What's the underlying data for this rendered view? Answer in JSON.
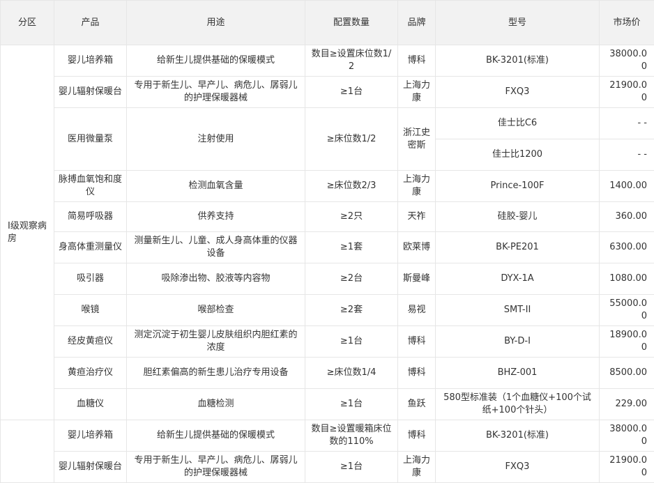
{
  "headers": [
    "分区",
    "产品",
    "用途",
    "配置数量",
    "品牌",
    "型号",
    "市场价"
  ],
  "section1": {
    "zone": "I级观察病房",
    "rows": [
      {
        "product": "婴儿培养箱",
        "usage": "给新生儿提供基础的保暖模式",
        "qty": "数目≥设置床位数1/2",
        "brand": "博科",
        "model": "BK-3201(标准)",
        "price": "38000.00"
      },
      {
        "product": "婴儿辐射保暖台",
        "usage": "专用于新生儿、早产儿、病危儿、孱弱儿的护理保暖器械",
        "qty": "≥1台",
        "brand": "上海力康",
        "model": "FXQ3",
        "price": "21900.00"
      },
      {
        "product": "医用微量泵",
        "usage": "注射使用",
        "qty": "≥床位数1/2",
        "brand": "浙江史密斯",
        "model": "佳士比C6",
        "price": "- -",
        "model2": "佳士比1200",
        "price2": "- -"
      },
      {
        "product": "脉搏血氧饱和度仪",
        "usage": "检测血氧含量",
        "qty": "≥床位数2/3",
        "brand": "上海力康",
        "model": "Prince-100F",
        "price": "1400.00"
      },
      {
        "product": "简易呼吸器",
        "usage": "供养支持",
        "qty": "≥2只",
        "brand": "天祚",
        "model": "硅胶-婴儿",
        "price": "360.00"
      },
      {
        "product": "身高体重测量仪",
        "usage": "测量新生儿、儿童、成人身高体重的仪器设备",
        "qty": "≥1套",
        "brand": "欧莱博",
        "model": "BK-PE201",
        "price": "6300.00"
      },
      {
        "product": "吸引器",
        "usage": "吸除渗出物、胶液等内容物",
        "qty": "≥2台",
        "brand": "斯曼峰",
        "model": "DYX-1A",
        "price": "1080.00"
      },
      {
        "product": "喉镜",
        "usage": "喉部检查",
        "qty": "≥2套",
        "brand": "易视",
        "model": "SMT-II",
        "price": "55000.00"
      },
      {
        "product": "经皮黄疸仪",
        "usage": "测定沉淀于初生婴儿皮肤组织内胆红素的浓度",
        "qty": "≥1台",
        "brand": "博科",
        "model": "BY-D-I",
        "price": "18900.00"
      },
      {
        "product": "黄疸治疗仪",
        "usage": "胆红素偏高的新生患儿治疗专用设备",
        "qty": "≥床位数1/4",
        "brand": "博科",
        "model": "BHZ-001",
        "price": "8500.00"
      },
      {
        "product": "血糖仪",
        "usage": "血糖检测",
        "qty": "≥1台",
        "brand": "鱼跃",
        "model": "580型标准装（1个血糖仪+100个试纸+100个针头）",
        "price": "229.00"
      }
    ]
  },
  "section2": {
    "rows": [
      {
        "product": "婴儿培养箱",
        "usage": "给新生儿提供基础的保暖模式",
        "qty": "数目≥设置暖箱床位数的110%",
        "brand": "博科",
        "model": "BK-3201(标准)",
        "price": "38000.00"
      },
      {
        "product": "婴儿辐射保暖台",
        "usage": "专用于新生儿、早产儿、病危儿、孱弱儿的护理保暖器械",
        "qty": "≥1台",
        "brand": "上海力康",
        "model": "FXQ3",
        "price": "21900.00"
      }
    ]
  }
}
